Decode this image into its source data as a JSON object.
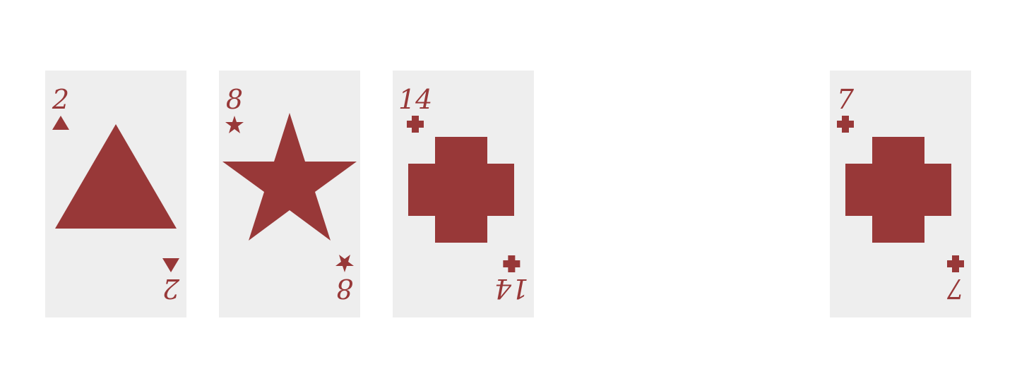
{
  "colors": {
    "suit": "#983838",
    "card_face": "#eeeeee",
    "table": "#ffffff"
  },
  "cards": [
    {
      "rank": "2",
      "suit": "triangle-icon"
    },
    {
      "rank": "8",
      "suit": "star-icon"
    },
    {
      "rank": "14",
      "suit": "cross-icon"
    },
    {
      "rank": "7",
      "suit": "cross-icon"
    }
  ]
}
